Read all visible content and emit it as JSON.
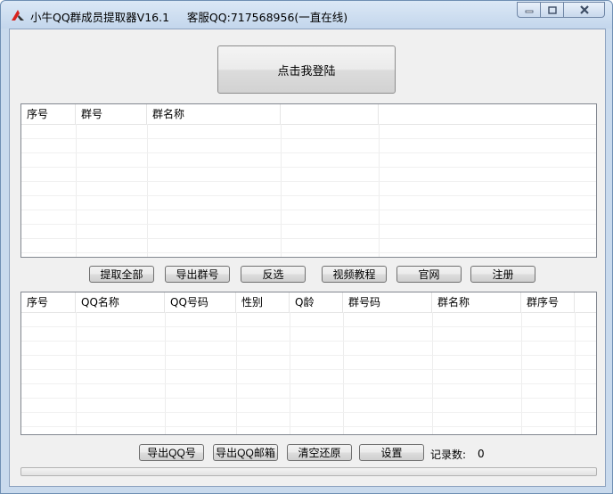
{
  "window": {
    "title": "小牛QQ群成员提取器V16.1     客服QQ:717568956(一直在线)",
    "icon": "app-logo-icon"
  },
  "login_button": {
    "label": "点击我登陆"
  },
  "group_table": {
    "columns": [
      "序号",
      "群号",
      "群名称",
      "",
      ""
    ],
    "rows": []
  },
  "group_actions": [
    {
      "label": "提取全部"
    },
    {
      "label": "导出群号"
    },
    {
      "label": "反选"
    },
    {
      "label": "视频教程"
    },
    {
      "label": "官网"
    },
    {
      "label": "注册"
    }
  ],
  "member_table": {
    "columns": [
      "序号",
      "QQ名称",
      "QQ号码",
      "性别",
      "Q龄",
      "群号码",
      "群名称",
      "群序号",
      ""
    ],
    "rows": []
  },
  "member_actions": [
    {
      "label": "导出QQ号"
    },
    {
      "label": "导出QQ邮箱"
    },
    {
      "label": "清空还原"
    },
    {
      "label": "设置"
    }
  ],
  "record_count": {
    "label": "记录数:",
    "value": "0"
  },
  "progress": {
    "fraction": 0,
    "color": "#06b025"
  },
  "colors": {
    "title_bar": "#c9daed",
    "client": "#f0f0f0",
    "accent_red": "#d9231e"
  }
}
